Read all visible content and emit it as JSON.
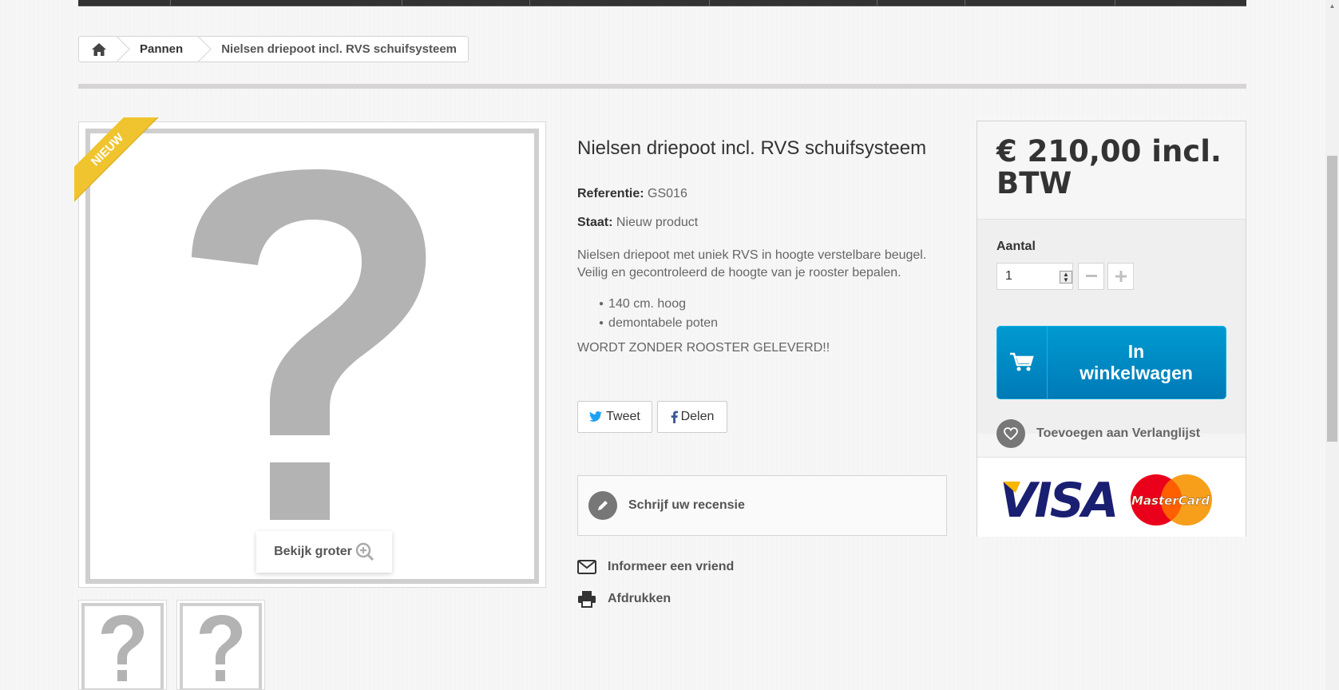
{
  "breadcrumb": {
    "home_icon": "home-icon",
    "category": "Pannen",
    "current": "Nielsen driepoot incl. RVS schuifsysteem"
  },
  "product": {
    "badge": "NIEUW",
    "enlarge_label": "Bekijk groter",
    "title": "Nielsen driepoot incl. RVS schuifsysteem",
    "reference_label": "Referentie:",
    "reference_value": "GS016",
    "condition_label": "Staat:",
    "condition_value": "Nieuw product",
    "description_line1": "Nielsen driepoot met uniek RVS in hoogte verstelbare beugel.",
    "description_line2": "Veilig en gecontroleerd de hoogte van je rooster bepalen.",
    "bullets": [
      "140 cm. hoog",
      "demontabele poten"
    ],
    "warning": "WORDT ZONDER ROOSTER GELEVERD!!"
  },
  "social": {
    "tweet": "Tweet",
    "share": "Delen"
  },
  "actions": {
    "review": "Schrijf uw recensie",
    "tell_friend": "Informeer een vriend",
    "print": "Afdrukken"
  },
  "buy_box": {
    "price": "€ 210,00 incl. BTW",
    "quantity_label": "Aantal",
    "quantity_value": "1",
    "add_to_cart": "In winkelwagen",
    "wishlist": "Toevoegen aan Verlanglijst",
    "payment_logos": [
      "VISA",
      "MasterCard"
    ]
  },
  "colors": {
    "cart_button": "#0099d0",
    "ribbon": "#f0c42f",
    "visa_blue": "#1a1f71",
    "visa_gold": "#f7b600",
    "mastercard_red": "#eb001b",
    "mastercard_orange": "#f79e1b"
  }
}
